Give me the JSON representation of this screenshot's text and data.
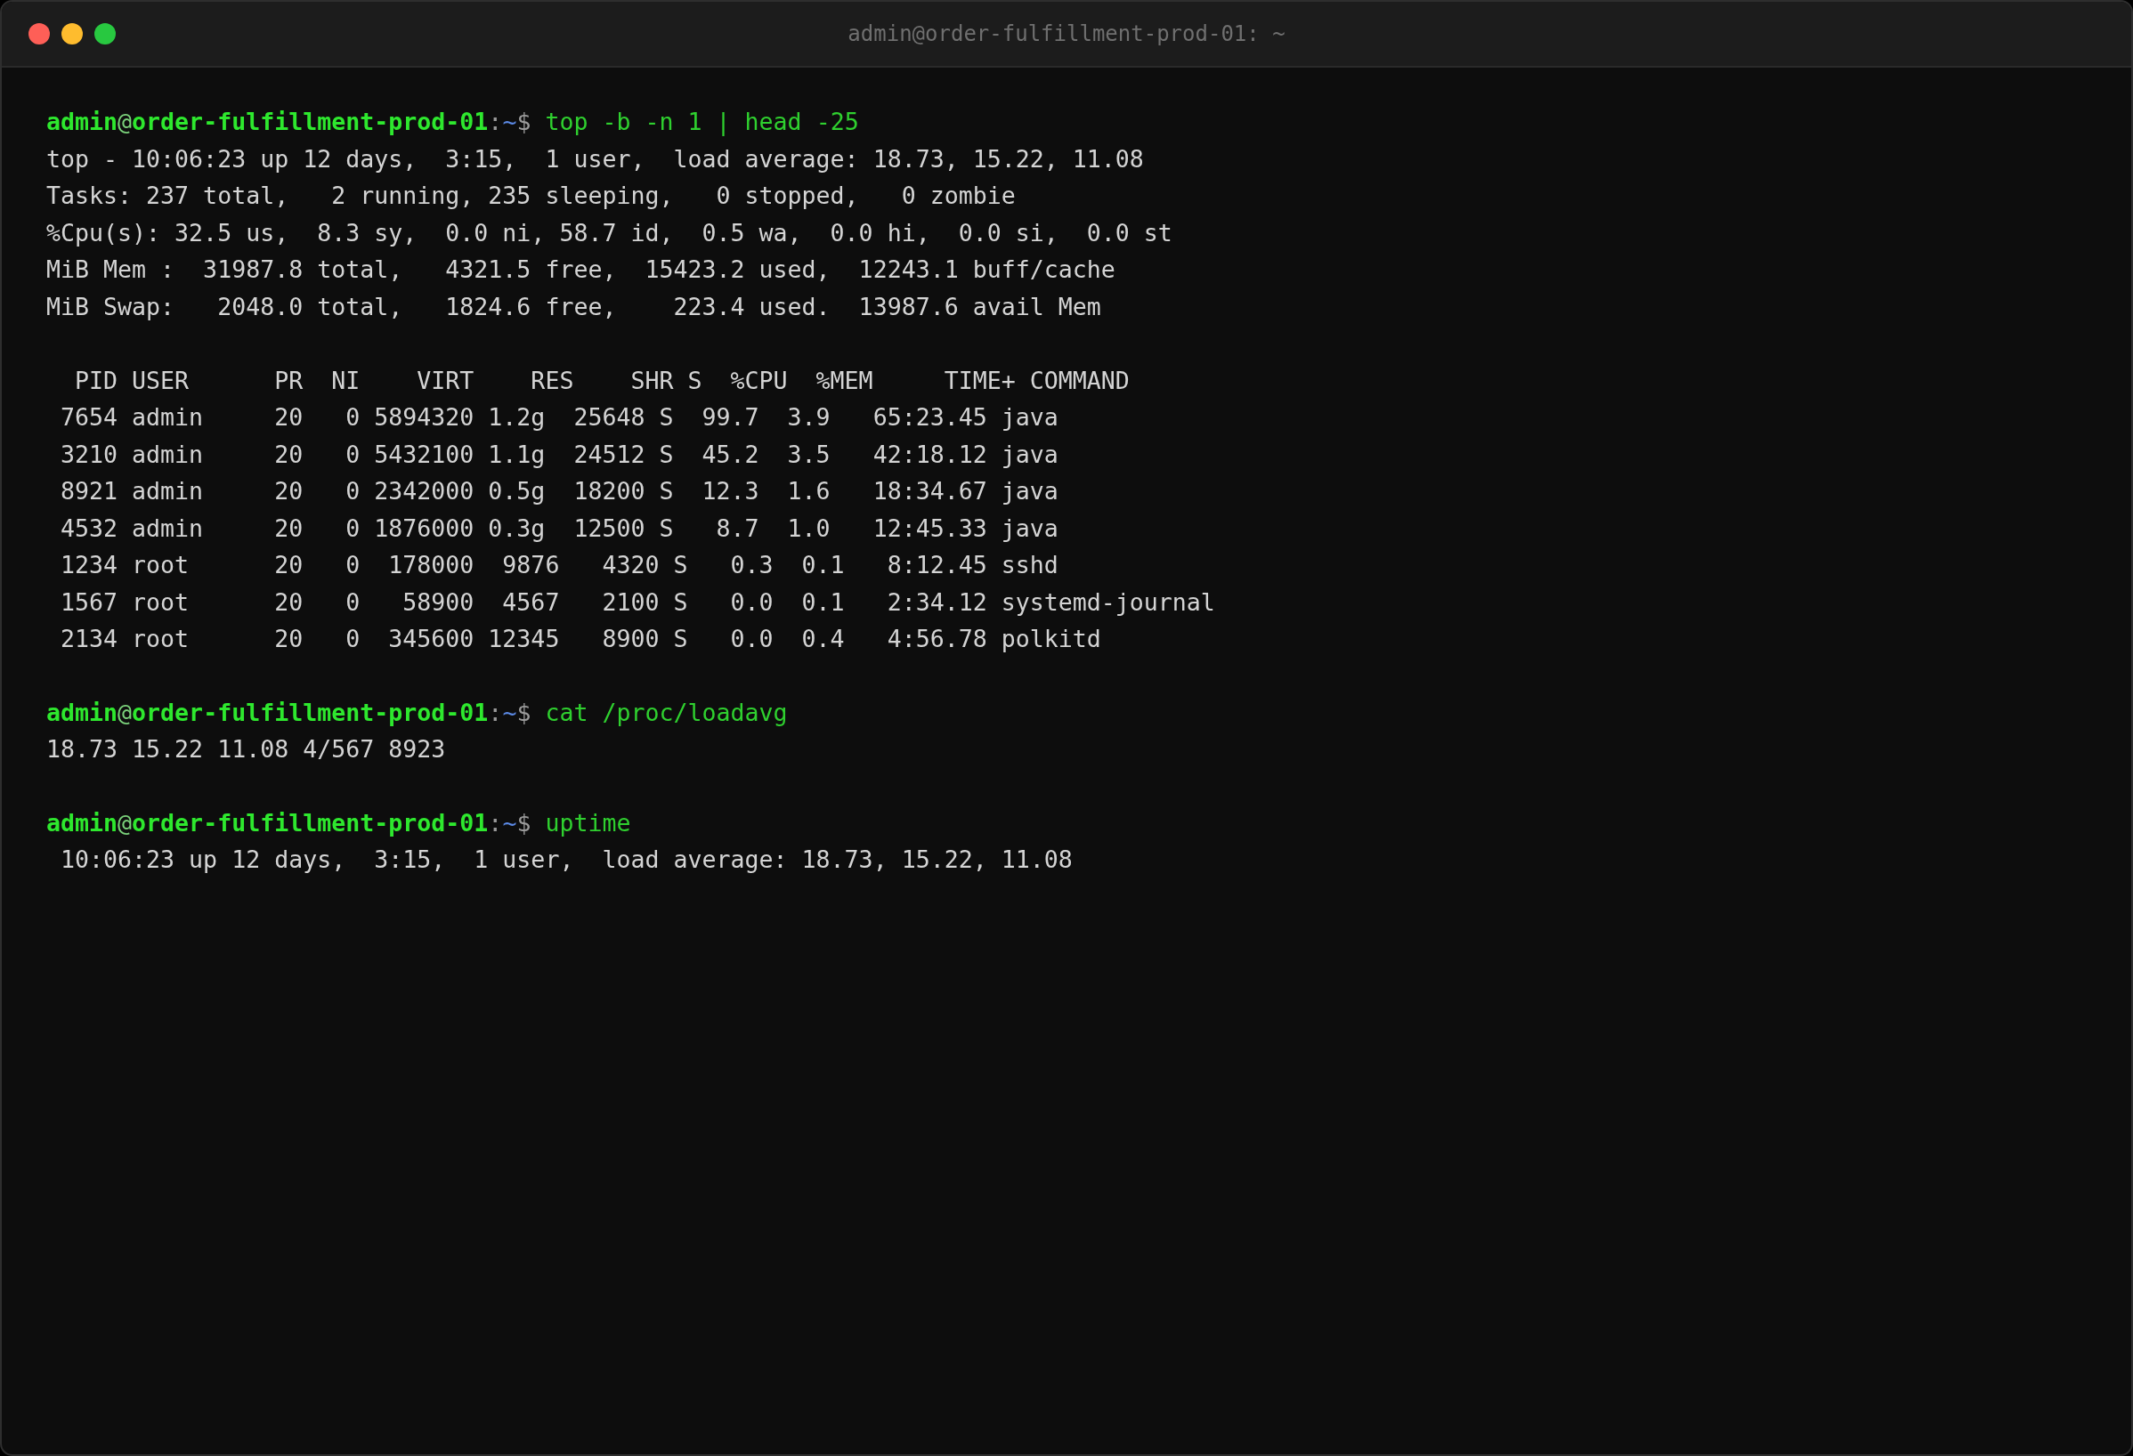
{
  "window": {
    "title": "admin@order-fulfillment-prod-01: ~"
  },
  "blocks": [
    {
      "prompt": {
        "user": "admin",
        "at": "@",
        "host": "order-fulfillment-prod-01",
        "sep": ":",
        "path": "~",
        "symbol": "$"
      },
      "command": "top -b -n 1 | head -25",
      "output": [
        "top - 10:06:23 up 12 days,  3:15,  1 user,  load average: 18.73, 15.22, 11.08",
        "Tasks: 237 total,   2 running, 235 sleeping,   0 stopped,   0 zombie",
        "%Cpu(s): 32.5 us,  8.3 sy,  0.0 ni, 58.7 id,  0.5 wa,  0.0 hi,  0.0 si,  0.0 st",
        "MiB Mem :  31987.8 total,   4321.5 free,  15423.2 used,  12243.1 buff/cache",
        "MiB Swap:   2048.0 total,   1824.6 free,    223.4 used.  13987.6 avail Mem"
      ],
      "table": {
        "header": "  PID USER      PR  NI    VIRT    RES    SHR S  %CPU  %MEM     TIME+ COMMAND",
        "rows": [
          " 7654 admin     20   0 5894320 1.2g  25648 S  99.7  3.9   65:23.45 java",
          " 3210 admin     20   0 5432100 1.1g  24512 S  45.2  3.5   42:18.12 java",
          " 8921 admin     20   0 2342000 0.5g  18200 S  12.3  1.6   18:34.67 java",
          " 4532 admin     20   0 1876000 0.3g  12500 S   8.7  1.0   12:45.33 java",
          " 1234 root      20   0  178000  9876   4320 S   0.3  0.1   8:12.45 sshd",
          " 1567 root      20   0   58900  4567   2100 S   0.0  0.1   2:34.12 systemd-journal",
          " 2134 root      20   0  345600 12345   8900 S   0.0  0.4   4:56.78 polkitd"
        ]
      }
    },
    {
      "prompt": {
        "user": "admin",
        "at": "@",
        "host": "order-fulfillment-prod-01",
        "sep": ":",
        "path": "~",
        "symbol": "$"
      },
      "command": "cat /proc/loadavg",
      "output": [
        "18.73 15.22 11.08 4/567 8923"
      ]
    },
    {
      "prompt": {
        "user": "admin",
        "at": "@",
        "host": "order-fulfillment-prod-01",
        "sep": ":",
        "path": "~",
        "symbol": "$"
      },
      "command": "uptime",
      "output": [
        " 10:06:23 up 12 days,  3:15,  1 user,  load average: 18.73, 15.22, 11.08"
      ]
    }
  ]
}
